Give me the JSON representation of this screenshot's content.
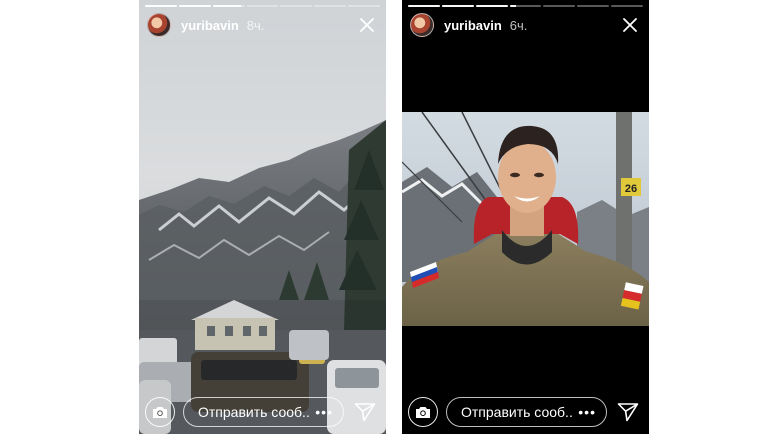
{
  "stories": [
    {
      "username": "yuribavin",
      "time": "8ч.",
      "reply_placeholder": "Отправить сооб...",
      "more": "•••",
      "progress": [
        1,
        1,
        0.9,
        0,
        0,
        0,
        0
      ]
    },
    {
      "username": "yuribavin",
      "time": "6ч.",
      "reply_placeholder": "Отправить сооб...",
      "more": "•••",
      "progress": [
        1,
        1,
        1,
        0.2,
        0,
        0,
        0
      ]
    }
  ],
  "photo_right": {
    "seat_number": "26"
  },
  "icons": {
    "close": "close-icon",
    "camera": "camera-icon",
    "send": "send-icon",
    "more": "more-icon"
  },
  "colors": {
    "overlay_text": "#ffffff",
    "story_bg_right": "#000000"
  }
}
